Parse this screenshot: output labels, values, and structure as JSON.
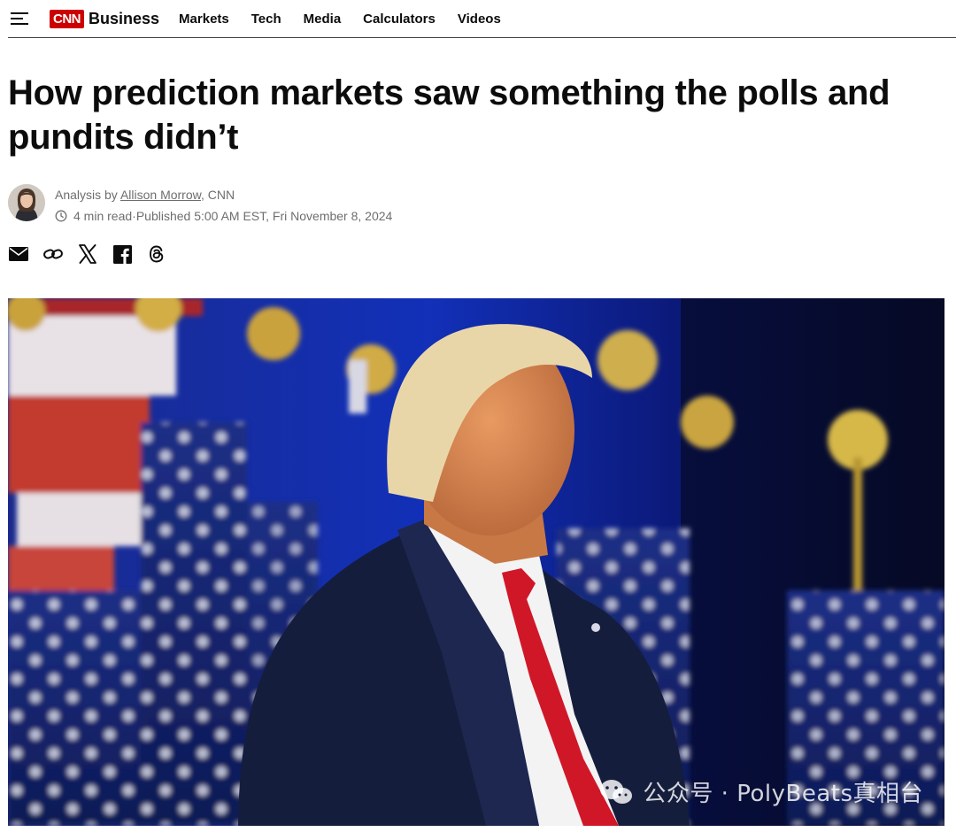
{
  "nav": {
    "brand_logo": "CNN",
    "brand_name": "Business",
    "links": [
      "Markets",
      "Tech",
      "Media",
      "Calculators",
      "Videos"
    ]
  },
  "article": {
    "headline": "How prediction markets saw something the polls and pundits didn’t",
    "byline_prefix": "Analysis by ",
    "author": "Allison Morrow",
    "byline_suffix": ", CNN",
    "read_time": "4 min read",
    "separator": " · ",
    "published": "Published 5:00 AM EST, Fri November 8, 2024"
  },
  "share": {
    "icons": [
      "email-icon",
      "link-icon",
      "x-icon",
      "facebook-icon",
      "threads-icon"
    ]
  },
  "hero": {
    "watermark": "公众号 · PolyBeats真相台"
  },
  "colors": {
    "brand_red": "#cc0000",
    "text": "#0c0c0c",
    "meta_gray": "#6e6e6e"
  }
}
